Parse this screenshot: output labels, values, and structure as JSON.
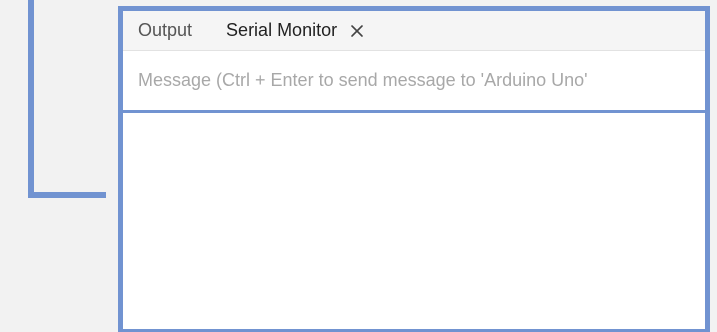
{
  "tabs": {
    "output_label": "Output",
    "serial_monitor_label": "Serial Monitor",
    "close_icon": "close-icon"
  },
  "serial_monitor": {
    "message_placeholder": "Message (Ctrl + Enter to send message to 'Arduino Uno'",
    "message_value": ""
  },
  "colors": {
    "highlight": "#7193d1",
    "background": "#f2f2f2",
    "panel": "#ffffff",
    "tab_bar": "#f5f5f5"
  }
}
